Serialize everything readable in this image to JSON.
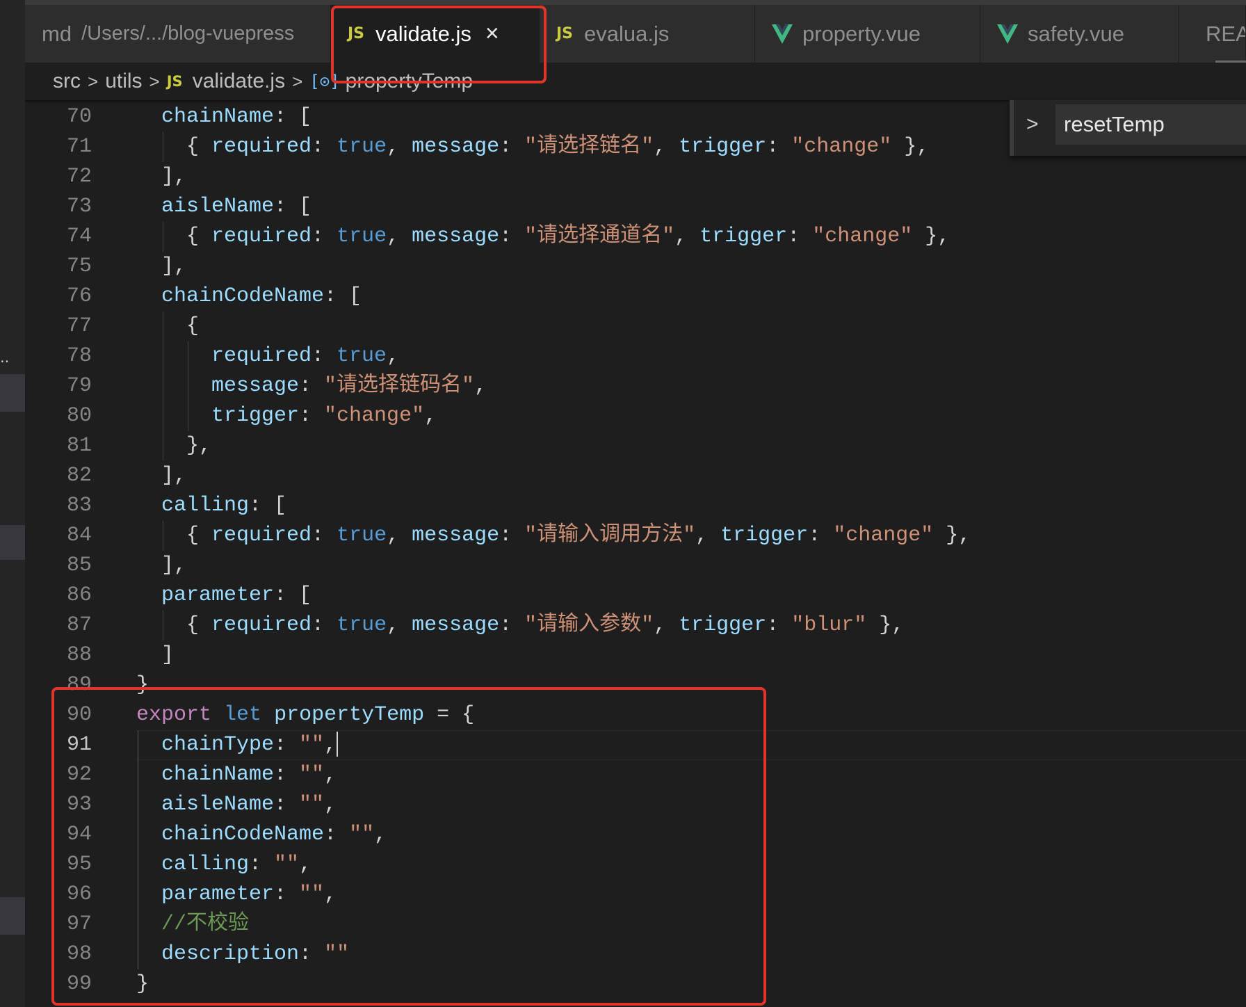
{
  "tabs": [
    {
      "icon": "",
      "label": "md",
      "path": "/Users/.../blog-vuepress",
      "active": false
    },
    {
      "icon": "JS",
      "label": "validate.js",
      "close": "×",
      "active": true
    },
    {
      "icon": "JS",
      "label": "evalua.js",
      "active": false
    },
    {
      "icon": "vue-icon",
      "label": "property.vue",
      "active": false
    },
    {
      "icon": "vue-icon",
      "label": "safety.vue",
      "active": false
    },
    {
      "icon": "info-icon",
      "label": "REA",
      "active": false
    }
  ],
  "breadcrumb": {
    "items": [
      "src",
      "utils",
      "validate.js",
      "propertyTemp"
    ],
    "file_icon": "JS"
  },
  "outline": {
    "label": "resetTemp"
  },
  "lines": [
    {
      "n": "70",
      "t": [
        [
          "k",
          "chainName"
        ],
        [
          "p",
          ": ["
        ]
      ],
      "indent": 1
    },
    {
      "n": "71",
      "t": [
        [
          "p",
          "{ "
        ],
        [
          "k",
          "required"
        ],
        [
          "p",
          ": "
        ],
        [
          "b",
          "true"
        ],
        [
          "p",
          ", "
        ],
        [
          "k",
          "message"
        ],
        [
          "p",
          ": "
        ],
        [
          "s",
          "\"请选择链名\""
        ],
        [
          "p",
          ", "
        ],
        [
          "k",
          "trigger"
        ],
        [
          "p",
          ": "
        ],
        [
          "s",
          "\"change\""
        ],
        [
          "p",
          " },"
        ]
      ],
      "indent": 2
    },
    {
      "n": "72",
      "t": [
        [
          "p",
          "],"
        ]
      ],
      "indent": 1
    },
    {
      "n": "73",
      "t": [
        [
          "k",
          "aisleName"
        ],
        [
          "p",
          ": ["
        ]
      ],
      "indent": 1
    },
    {
      "n": "74",
      "t": [
        [
          "p",
          "{ "
        ],
        [
          "k",
          "required"
        ],
        [
          "p",
          ": "
        ],
        [
          "b",
          "true"
        ],
        [
          "p",
          ", "
        ],
        [
          "k",
          "message"
        ],
        [
          "p",
          ": "
        ],
        [
          "s",
          "\"请选择通道名\""
        ],
        [
          "p",
          ", "
        ],
        [
          "k",
          "trigger"
        ],
        [
          "p",
          ": "
        ],
        [
          "s",
          "\"change\""
        ],
        [
          "p",
          " },"
        ]
      ],
      "indent": 2
    },
    {
      "n": "75",
      "t": [
        [
          "p",
          "],"
        ]
      ],
      "indent": 1
    },
    {
      "n": "76",
      "t": [
        [
          "k",
          "chainCodeName"
        ],
        [
          "p",
          ": ["
        ]
      ],
      "indent": 1
    },
    {
      "n": "77",
      "t": [
        [
          "p",
          "{"
        ]
      ],
      "indent": 2
    },
    {
      "n": "78",
      "t": [
        [
          "k",
          "required"
        ],
        [
          "p",
          ": "
        ],
        [
          "b",
          "true"
        ],
        [
          "p",
          ","
        ]
      ],
      "indent": 3
    },
    {
      "n": "79",
      "t": [
        [
          "k",
          "message"
        ],
        [
          "p",
          ": "
        ],
        [
          "s",
          "\"请选择链码名\""
        ],
        [
          "p",
          ","
        ]
      ],
      "indent": 3
    },
    {
      "n": "80",
      "t": [
        [
          "k",
          "trigger"
        ],
        [
          "p",
          ": "
        ],
        [
          "s",
          "\"change\""
        ],
        [
          "p",
          ","
        ]
      ],
      "indent": 3
    },
    {
      "n": "81",
      "t": [
        [
          "p",
          "},"
        ]
      ],
      "indent": 2
    },
    {
      "n": "82",
      "t": [
        [
          "p",
          "],"
        ]
      ],
      "indent": 1
    },
    {
      "n": "83",
      "t": [
        [
          "k",
          "calling"
        ],
        [
          "p",
          ": ["
        ]
      ],
      "indent": 1
    },
    {
      "n": "84",
      "t": [
        [
          "p",
          "{ "
        ],
        [
          "k",
          "required"
        ],
        [
          "p",
          ": "
        ],
        [
          "b",
          "true"
        ],
        [
          "p",
          ", "
        ],
        [
          "k",
          "message"
        ],
        [
          "p",
          ": "
        ],
        [
          "s",
          "\"请输入调用方法\""
        ],
        [
          "p",
          ", "
        ],
        [
          "k",
          "trigger"
        ],
        [
          "p",
          ": "
        ],
        [
          "s",
          "\"change\""
        ],
        [
          "p",
          " },"
        ]
      ],
      "indent": 2
    },
    {
      "n": "85",
      "t": [
        [
          "p",
          "],"
        ]
      ],
      "indent": 1
    },
    {
      "n": "86",
      "t": [
        [
          "k",
          "parameter"
        ],
        [
          "p",
          ": ["
        ]
      ],
      "indent": 1
    },
    {
      "n": "87",
      "t": [
        [
          "p",
          "{ "
        ],
        [
          "k",
          "required"
        ],
        [
          "p",
          ": "
        ],
        [
          "b",
          "true"
        ],
        [
          "p",
          ", "
        ],
        [
          "k",
          "message"
        ],
        [
          "p",
          ": "
        ],
        [
          "s",
          "\"请输入参数\""
        ],
        [
          "p",
          ", "
        ],
        [
          "k",
          "trigger"
        ],
        [
          "p",
          ": "
        ],
        [
          "s",
          "\"blur\""
        ],
        [
          "p",
          " },"
        ]
      ],
      "indent": 2
    },
    {
      "n": "88",
      "t": [
        [
          "p",
          "]"
        ]
      ],
      "indent": 1
    },
    {
      "n": "89",
      "t": [
        [
          "p",
          "}"
        ]
      ],
      "indent": 0
    },
    {
      "n": "90",
      "t": [
        [
          "kw",
          "export"
        ],
        [
          "p",
          " "
        ],
        [
          "b",
          "let"
        ],
        [
          "p",
          " "
        ],
        [
          "k",
          "propertyTemp"
        ],
        [
          "p",
          " = {"
        ]
      ],
      "indent": 0
    },
    {
      "n": "91",
      "t": [
        [
          "k",
          "chainType"
        ],
        [
          "p",
          ": "
        ],
        [
          "s",
          "\"\""
        ],
        [
          "p",
          ","
        ]
      ],
      "indent": 1,
      "current": true
    },
    {
      "n": "92",
      "t": [
        [
          "k",
          "chainName"
        ],
        [
          "p",
          ": "
        ],
        [
          "s",
          "\"\""
        ],
        [
          "p",
          ","
        ]
      ],
      "indent": 1
    },
    {
      "n": "93",
      "t": [
        [
          "k",
          "aisleName"
        ],
        [
          "p",
          ": "
        ],
        [
          "s",
          "\"\""
        ],
        [
          "p",
          ","
        ]
      ],
      "indent": 1
    },
    {
      "n": "94",
      "t": [
        [
          "k",
          "chainCodeName"
        ],
        [
          "p",
          ": "
        ],
        [
          "s",
          "\"\""
        ],
        [
          "p",
          ","
        ]
      ],
      "indent": 1
    },
    {
      "n": "95",
      "t": [
        [
          "k",
          "calling"
        ],
        [
          "p",
          ": "
        ],
        [
          "s",
          "\"\""
        ],
        [
          "p",
          ","
        ]
      ],
      "indent": 1
    },
    {
      "n": "96",
      "t": [
        [
          "k",
          "parameter"
        ],
        [
          "p",
          ": "
        ],
        [
          "s",
          "\"\""
        ],
        [
          "p",
          ","
        ]
      ],
      "indent": 1
    },
    {
      "n": "97",
      "t": [
        [
          "cm",
          "//不校验"
        ]
      ],
      "indent": 1
    },
    {
      "n": "98",
      "t": [
        [
          "k",
          "description"
        ],
        [
          "p",
          ": "
        ],
        [
          "s",
          "\"\""
        ]
      ],
      "indent": 1
    },
    {
      "n": "99",
      "t": [
        [
          "p",
          "}"
        ]
      ],
      "indent": 0
    }
  ],
  "colors": {
    "accent_red": "#e0352b",
    "editor_bg": "#1e1e1e",
    "key": "#9cdcfe",
    "string": "#ce9178",
    "bool": "#569cd6",
    "keyword": "#c586c0",
    "comment": "#6a9955"
  }
}
